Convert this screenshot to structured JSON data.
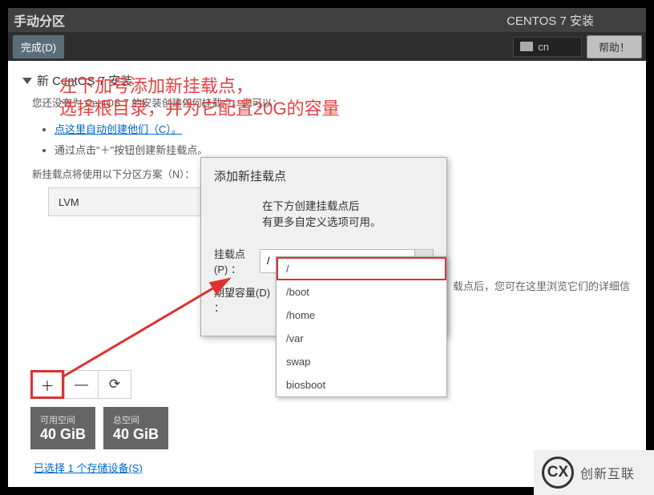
{
  "topbar": {
    "title_left": "手动分区",
    "title_right": "CENTOS 7 安装",
    "done_btn": "完成(D)",
    "lang": "cn",
    "help_btn": "帮助！"
  },
  "overlay": {
    "line1": "左下加号添加新挂载点，",
    "line2": "选择根目录，并为它配置20G的容量"
  },
  "left": {
    "expander_title": "新 CentOS 7 安装",
    "no_mount_text": "您还没有为 CentOS 7 的安装创建任何挂载点。您可以：",
    "auto_create_link": "点这里自动创建他们（C）。",
    "plus_hint": "通过点击\"＋\"按钮创建新挂载点。",
    "scheme_text": "新挂载点将使用以下分区方案（N）：",
    "scheme_value": "LVM"
  },
  "right_hint": "载点后，您可在这里浏览它们的详细信",
  "buttons": {
    "add_glyph": "＋",
    "remove_glyph": "—",
    "reload_glyph": "⟳"
  },
  "space": {
    "avail_label": "可用空间",
    "avail_value": "40 GiB",
    "total_label": "总空间",
    "total_value": "40 GiB",
    "selected_link": "已选择 1 个存储设备(S)"
  },
  "dialog": {
    "title": "添加新挂载点",
    "desc": "在下方创建挂载点后\n有更多自定义选项可用。",
    "mount_label": "挂载点(P) ：",
    "mount_value": "/",
    "size_label": "期望容量(D) ：",
    "size_value": "",
    "options": [
      "/",
      "/boot",
      "/home",
      "/var",
      "swap",
      "biosboot"
    ]
  },
  "watermark": {
    "icon_text": "CX",
    "text": "创新互联"
  }
}
